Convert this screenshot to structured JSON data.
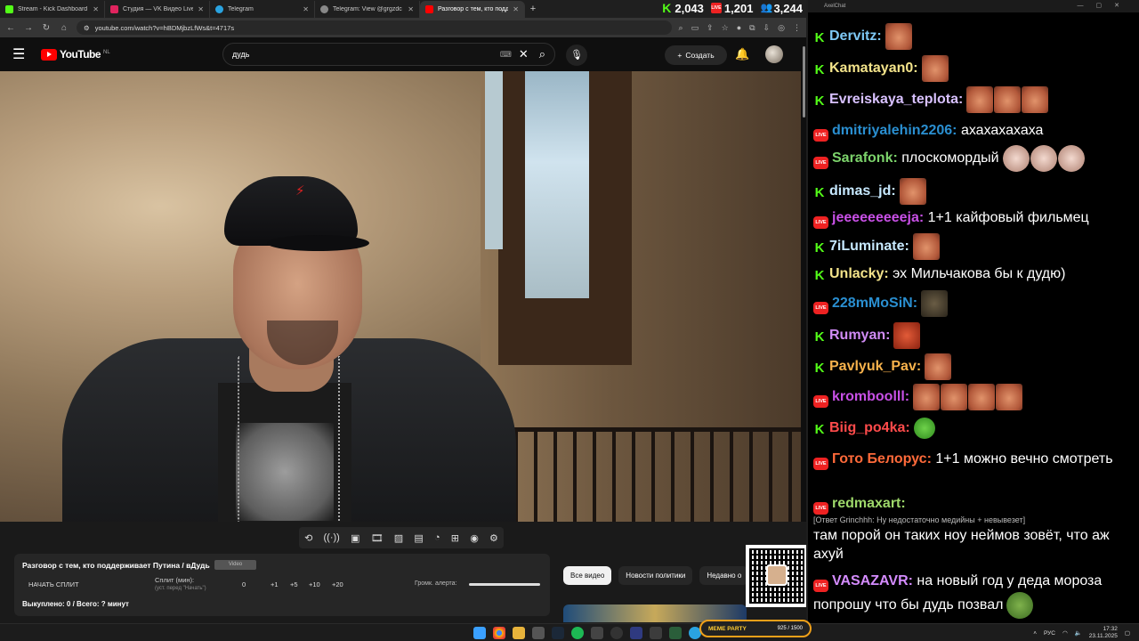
{
  "browser": {
    "tabs": [
      {
        "label": "Stream - Kick Dashboard",
        "color": "#53fc18",
        "active": false
      },
      {
        "label": "Студия — VK Видео Live",
        "color": "#e0245e",
        "active": false
      },
      {
        "label": "Telegram",
        "color": "#2aa3e0",
        "active": false
      },
      {
        "label": "Telegram: View @grgzdc",
        "color": "#888888",
        "active": false
      },
      {
        "label": "Разговор с тем, кто поддерж...",
        "color": "#ff0000",
        "active": true
      }
    ],
    "url": "youtube.com/watch?v=hBDMjbzLfWs&t=4717s"
  },
  "counters": {
    "kick": "2,043",
    "live": "1,201",
    "viewers": "3,244"
  },
  "youtube": {
    "logo": "YouTube",
    "region": "NL",
    "search_query": "дудь",
    "create_label": "Создать"
  },
  "panel": {
    "title": "Разговор с тем, кто поддерживает Путина / вДудь",
    "badge": "Video",
    "start_split": "НАЧАТЬ СПЛИТ",
    "split_label": "Сплит (мин):",
    "split_hint": "(уст. перед \"Начать\")",
    "split_value": "0",
    "inc": [
      "+1",
      "+5",
      "+10",
      "+20"
    ],
    "volume_label": "Громк. алерта:",
    "bought": "Выкуплено: 0 / Всего: ? минут"
  },
  "chips": [
    "Все видео",
    "Новости политики",
    "Недавно о"
  ],
  "chat": {
    "window_title": "AxelChat",
    "messages": [
      {
        "platform": "kick",
        "user": "Dervitz:",
        "color": "#7ec8f5",
        "text": "",
        "emotes": [
          "face"
        ]
      },
      {
        "platform": "kick",
        "user": "Kamatayan0:",
        "color": "#f3e38a",
        "text": "",
        "emotes": [
          "face"
        ]
      },
      {
        "platform": "kick",
        "user": "Evreiskaya_teplota:",
        "color": "#d8c1ff",
        "text": "",
        "emotes": [
          "face",
          "face",
          "face"
        ]
      },
      {
        "platform": "live",
        "user": "dmitriyalehin2206:",
        "color": "#2a8fd1",
        "text": "ахахахахаха",
        "emotes": []
      },
      {
        "platform": "live",
        "user": "Sarafonk:",
        "color": "#7cd36b",
        "text": "плоскомордый",
        "emotes": [
          "pale",
          "pale",
          "pale"
        ]
      },
      {
        "platform": "kick",
        "user": "dimas_jd:",
        "color": "#c7e9ff",
        "text": "",
        "emotes": [
          "face"
        ]
      },
      {
        "platform": "live",
        "user": "jeeeeeeeeeja:",
        "color": "#c850e6",
        "text": "1+1 кайфовый фильмец",
        "emotes": []
      },
      {
        "platform": "kick",
        "user": "7iLuminate:",
        "color": "#c7e9ff",
        "text": "",
        "emotes": [
          "face"
        ]
      },
      {
        "platform": "kick",
        "user": "Unlacky:",
        "color": "#f3e38a",
        "text": "эх Мильчакова бы к дудю)",
        "emotes": []
      },
      {
        "platform": "live",
        "user": "228mMoSiN:",
        "color": "#2a8fd1",
        "text": "",
        "emotes": [
          "dark"
        ]
      },
      {
        "platform": "kick",
        "user": "Rumyan:",
        "color": "#d08bf5",
        "text": "",
        "emotes": [
          "red"
        ]
      },
      {
        "platform": "kick",
        "user": "Pavlyuk_Pav:",
        "color": "#f7b24c",
        "text": "",
        "emotes": [
          "face"
        ]
      },
      {
        "platform": "live",
        "user": "kromboolll:",
        "color": "#c850e6",
        "text": "",
        "emotes": [
          "face",
          "face",
          "face",
          "face"
        ]
      },
      {
        "platform": "kick",
        "user": "Biig_po4ka:",
        "color": "#ff4b4b",
        "text": "",
        "emotes": [
          "green"
        ]
      },
      {
        "platform": "live",
        "user": "Гото Белорус:",
        "color": "#ff6a3a",
        "text": "1+1 можно вечно смотреть",
        "emotes": []
      },
      {
        "platform": "live",
        "user": "redmaxart:",
        "color": "#9ed86a",
        "text": "там порой он таких ноу неймов зовёт, что аж ахуй",
        "reply": "[Ответ Grinchhh: Ну недостаточно медийны + невывезет]",
        "emotes": []
      },
      {
        "platform": "live",
        "user": "VASAZAVR:",
        "color": "#d58cff",
        "text": "на новый год у деда мороза попрошу что бы дудь позвал",
        "emotes": [
          "pepe"
        ]
      }
    ]
  },
  "taskbar": {
    "widget_name": "MEME PARTY",
    "widget_value": "925 / 1500",
    "lang": "РУС",
    "time": "17:32",
    "date": "23.11.2025"
  }
}
